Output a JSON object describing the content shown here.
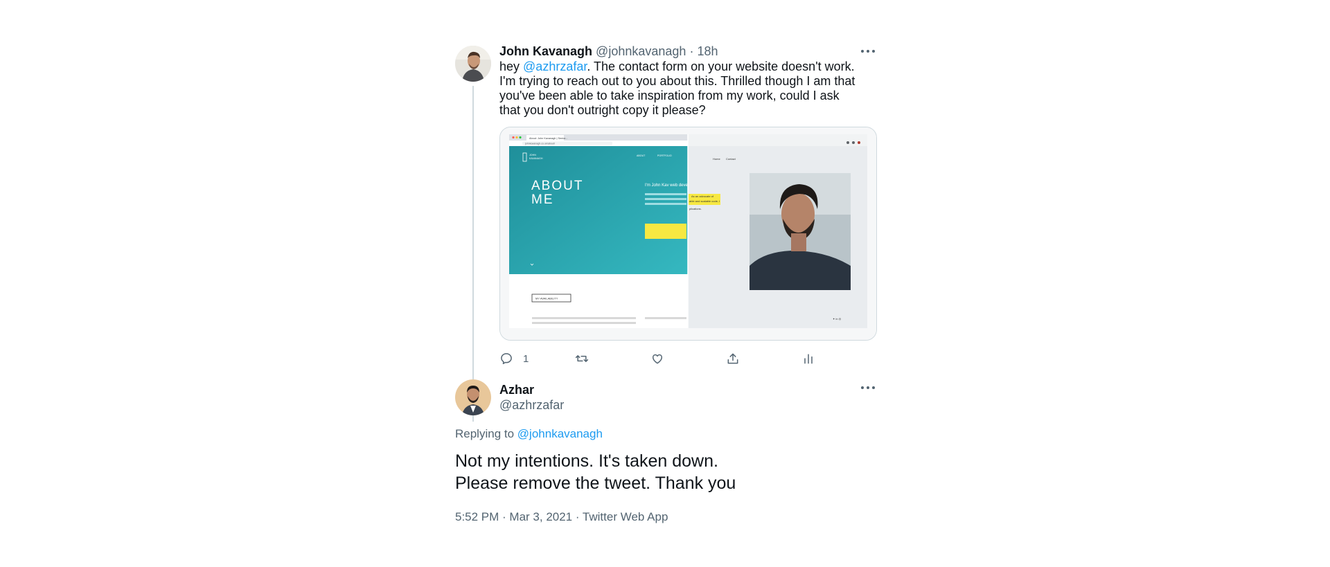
{
  "tweet1": {
    "author_name": "John Kavanagh",
    "author_handle": "@johnkavanagh",
    "time": "18h",
    "separator": "·",
    "text_pre": "hey ",
    "mention": "@azhrzafar",
    "text_post": ".  The contact form on your website doesn't work.  I'm trying to reach out to you about this.  Thrilled though I am that you've been able to take inspiration from my work, could I ask that you don't outright copy it please?",
    "actions": {
      "reply_count": "1"
    },
    "media": {
      "browser_tab": "About: John Kavanagh | Senior...",
      "address": "johnkavanagh.co.uk/about/",
      "logo_line1": "JOHN",
      "logo_line2": "KAVANAGH",
      "nav_about": "ABOUT",
      "nav_portfolio": "PORTFOLIO",
      "hero_line1": "ABOUT",
      "hero_line2": "ME",
      "button": "MY AVAILABILITY",
      "right_nav_home": "Home",
      "right_nav_contact": "Contact",
      "intro": "I'm John Kav web develop often found w",
      "highlight1": "As an advocate of",
      "highlight2": "able and scalable code, I",
      "applications": "plications."
    }
  },
  "tweet2": {
    "author_name": "Azhar",
    "author_handle": "@azhrzafar",
    "replying_prefix": "Replying to",
    "replying_to": "@johnkavanagh",
    "text_line1": "Not my intentions. It's taken down.",
    "text_line2": "Please remove the tweet. Thank you",
    "meta": "5:52 PM · Mar 3, 2021 · Twitter Web App"
  },
  "colors": {
    "link": "#1d9bf0",
    "muted": "#536471",
    "teal": "#2aa7b0",
    "line": "#cfd9de"
  },
  "icons": [
    "reply-icon",
    "retweet-icon",
    "like-icon",
    "share-icon",
    "analytics-icon",
    "more-icon"
  ]
}
